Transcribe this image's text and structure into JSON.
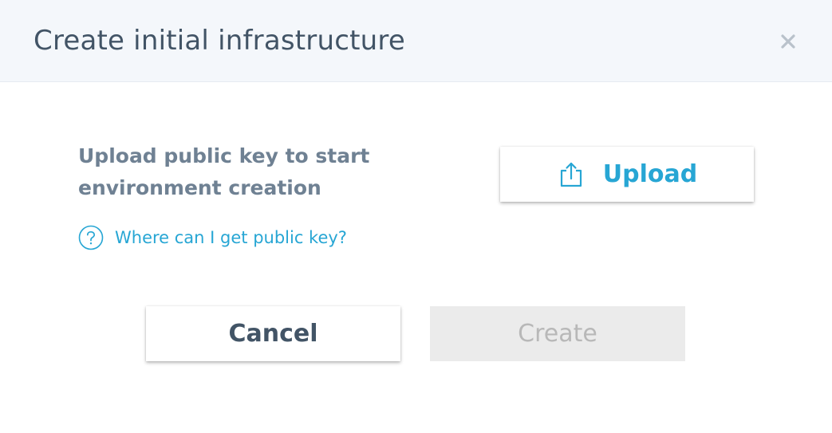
{
  "dialog": {
    "title": "Create initial infrastructure",
    "close_icon": "close-icon"
  },
  "content": {
    "prompt": "Upload public key to start\nenvironment creation",
    "help_link": "Where can I get public key?",
    "help_icon": "question-circle-icon"
  },
  "upload": {
    "label": "Upload",
    "icon": "upload-icon"
  },
  "footer": {
    "cancel_label": "Cancel",
    "create_label": "Create",
    "create_disabled": true
  },
  "colors": {
    "header_bg": "#f4f7fb",
    "title": "#425466",
    "accent": "#27a6d4",
    "muted_text": "#6f8193",
    "disabled_bg": "#ebebeb",
    "disabled_text": "#b8b8b8"
  }
}
